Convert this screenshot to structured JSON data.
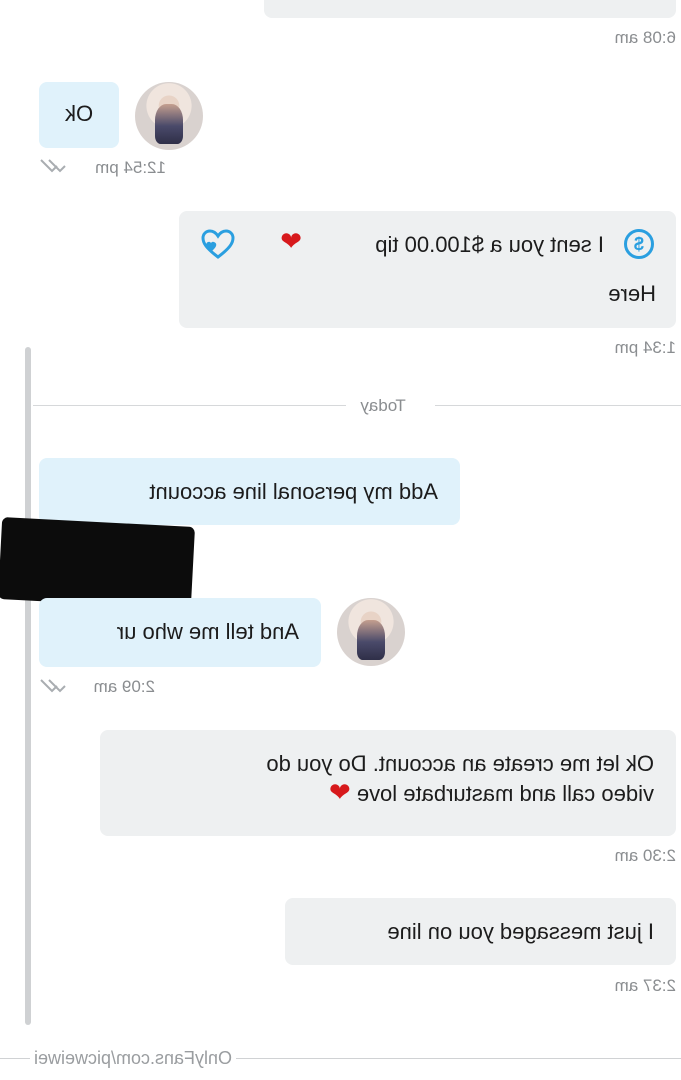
{
  "messages": {
    "m0_time": "6:08 am",
    "m1_text": "Ok",
    "m1_time": "12:54 pm",
    "m2_tip_text": "I sent you a $100.00 tip",
    "m2_text": "Here",
    "m2_time": "1:34 pm",
    "divider_label": "Today",
    "m3_text": "Add my personal line account",
    "m4_text": "And tell me who ur",
    "m4_time": "2:09 am",
    "m5_line1": "Ok let me create an account. Do you do",
    "m5_line2": "video call and masturbate love",
    "m5_time": "2:30 am",
    "m6_text": "I just messaged you on line",
    "m6_time": "2:37 am"
  },
  "watermark": "OnlyFans.com/picweiwei",
  "icons": {
    "dollar": "dollar-circle-icon",
    "heart": "red-heart-emoji",
    "like": "heart-like-icon",
    "read": "double-check-read-icon",
    "avatar": "user-avatar-photo"
  },
  "colors": {
    "accent_blue": "#2a9fe0",
    "incoming_bubble": "#e0f2fb",
    "outgoing_bubble": "#eef0f1",
    "heart_red": "#d7191c"
  }
}
